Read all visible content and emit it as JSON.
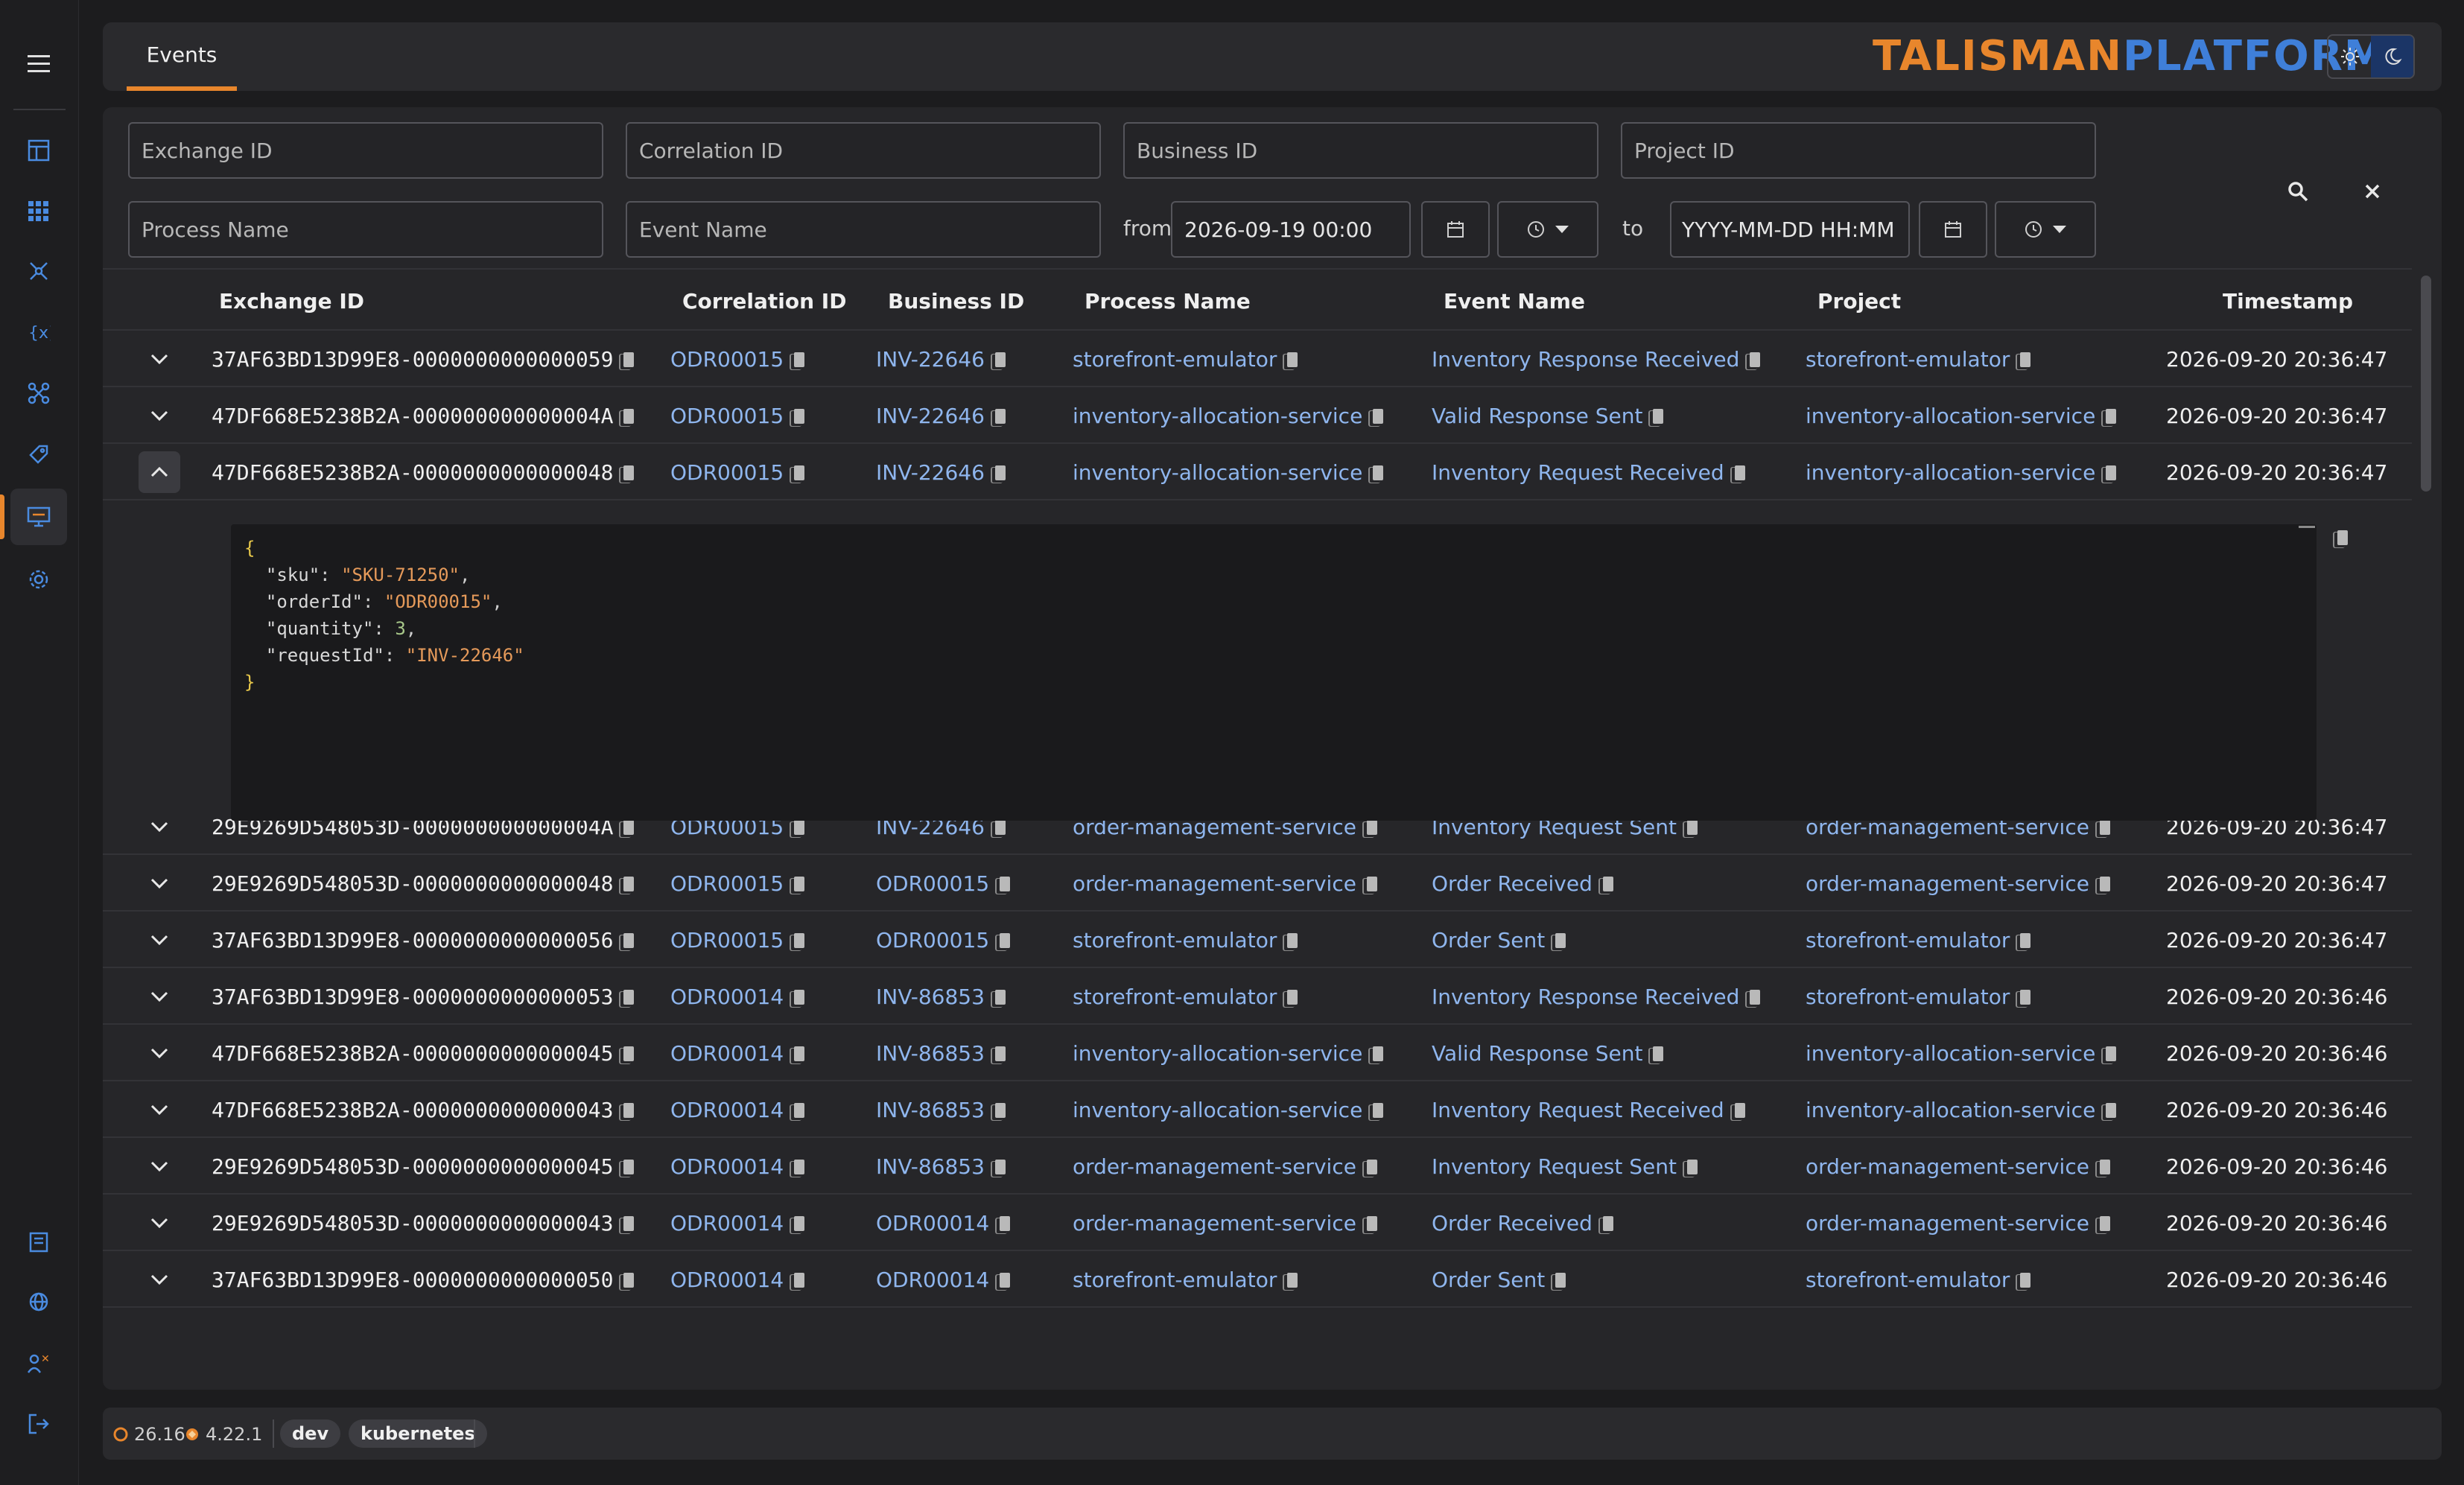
{
  "brand": {
    "part1": "TALISMAN",
    "part2": "PLATFORM"
  },
  "tabs": [
    {
      "label": "Events"
    }
  ],
  "filters": {
    "exchange_id": "Exchange ID",
    "correlation_id": "Correlation ID",
    "business_id": "Business ID",
    "project_id": "Project ID",
    "process_name": "Process Name",
    "event_name": "Event Name",
    "from_label": "from",
    "from_value": "2026-09-19 00:00",
    "to_label": "to",
    "to_placeholder": "YYYY-MM-DD HH:MM"
  },
  "columns": [
    "Exchange ID",
    "Correlation ID",
    "Business ID",
    "Process Name",
    "Event Name",
    "Project",
    "Timestamp"
  ],
  "rows": [
    {
      "ex": "37AF63BD13D99E8-0000000000000059",
      "corr": "ODR00015",
      "bus": "INV-22646",
      "proc": "storefront-emulator",
      "event": "Inventory Response Received",
      "proj": "storefront-emulator",
      "ts": "2026-09-20 20:36:47"
    },
    {
      "ex": "47DF668E5238B2A-000000000000004A",
      "corr": "ODR00015",
      "bus": "INV-22646",
      "proc": "inventory-allocation-service",
      "event": "Valid Response Sent",
      "proj": "inventory-allocation-service",
      "ts": "2026-09-20 20:36:47"
    },
    {
      "ex": "47DF668E5238B2A-0000000000000048",
      "corr": "ODR00015",
      "bus": "INV-22646",
      "proc": "inventory-allocation-service",
      "event": "Inventory Request Received",
      "proj": "inventory-allocation-service",
      "ts": "2026-09-20 20:36:47"
    },
    {
      "ex": "29E9269D548053D-000000000000004A",
      "corr": "ODR00015",
      "bus": "INV-22646",
      "proc": "order-management-service",
      "event": "Inventory Request Sent",
      "proj": "order-management-service",
      "ts": "2026-09-20 20:36:47"
    },
    {
      "ex": "29E9269D548053D-0000000000000048",
      "corr": "ODR00015",
      "bus": "ODR00015",
      "proc": "order-management-service",
      "event": "Order Received",
      "proj": "order-management-service",
      "ts": "2026-09-20 20:36:47"
    },
    {
      "ex": "37AF63BD13D99E8-0000000000000056",
      "corr": "ODR00015",
      "bus": "ODR00015",
      "proc": "storefront-emulator",
      "event": "Order Sent",
      "proj": "storefront-emulator",
      "ts": "2026-09-20 20:36:47"
    },
    {
      "ex": "37AF63BD13D99E8-0000000000000053",
      "corr": "ODR00014",
      "bus": "INV-86853",
      "proc": "storefront-emulator",
      "event": "Inventory Response Received",
      "proj": "storefront-emulator",
      "ts": "2026-09-20 20:36:46"
    },
    {
      "ex": "47DF668E5238B2A-0000000000000045",
      "corr": "ODR00014",
      "bus": "INV-86853",
      "proc": "inventory-allocation-service",
      "event": "Valid Response Sent",
      "proj": "inventory-allocation-service",
      "ts": "2026-09-20 20:36:46"
    },
    {
      "ex": "47DF668E5238B2A-0000000000000043",
      "corr": "ODR00014",
      "bus": "INV-86853",
      "proc": "inventory-allocation-service",
      "event": "Inventory Request Received",
      "proj": "inventory-allocation-service",
      "ts": "2026-09-20 20:36:46"
    },
    {
      "ex": "29E9269D548053D-0000000000000045",
      "corr": "ODR00014",
      "bus": "INV-86853",
      "proc": "order-management-service",
      "event": "Inventory Request Sent",
      "proj": "order-management-service",
      "ts": "2026-09-20 20:36:46"
    },
    {
      "ex": "29E9269D548053D-0000000000000043",
      "corr": "ODR00014",
      "bus": "ODR00014",
      "proc": "order-management-service",
      "event": "Order Received",
      "proj": "order-management-service",
      "ts": "2026-09-20 20:36:46"
    },
    {
      "ex": "37AF63BD13D99E8-0000000000000050",
      "corr": "ODR00014",
      "bus": "ODR00014",
      "proc": "storefront-emulator",
      "event": "Order Sent",
      "proj": "storefront-emulator",
      "ts": "2026-09-20 20:36:46"
    }
  ],
  "expanded_payload": {
    "open": "{",
    "sku_key": "\"sku\"",
    "sku_val": "\"SKU-71250\"",
    "order_key": "\"orderId\"",
    "order_val": "\"ODR00015\"",
    "qty_key": "\"quantity\"",
    "qty_val": "3",
    "req_key": "\"requestId\"",
    "req_val": "\"INV-22646\"",
    "close": "}"
  },
  "footer": {
    "v1": "26.16",
    "v2": "4.22.1",
    "badge1": "dev",
    "badge2": "kubernetes"
  },
  "colors": {
    "accent": "#e8862c",
    "brand_blue": "#3f7fd9",
    "link": "#8fb6ee"
  }
}
